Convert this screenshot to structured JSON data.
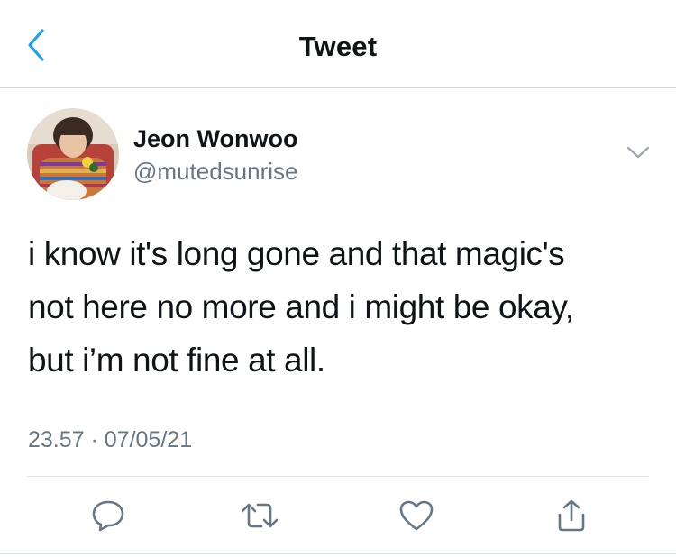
{
  "header": {
    "title": "Tweet",
    "back_icon": "chevron-left-icon"
  },
  "tweet": {
    "author_name": "Jeon Wonwoo",
    "author_handle": "@mutedsunrise",
    "text": "i know it's long gone and that magic's\nnot here no more and i might be okay,\nbut i’m not fine at all.",
    "timestamp": "23.57 · 07/05/21"
  },
  "actions": {
    "icons": [
      "reply-icon",
      "retweet-icon",
      "like-icon",
      "share-icon"
    ]
  },
  "colors": {
    "accent": "#1da1f2",
    "text": "#0f1419",
    "secondary_text": "#657786",
    "divider": "#e1e4e7"
  }
}
